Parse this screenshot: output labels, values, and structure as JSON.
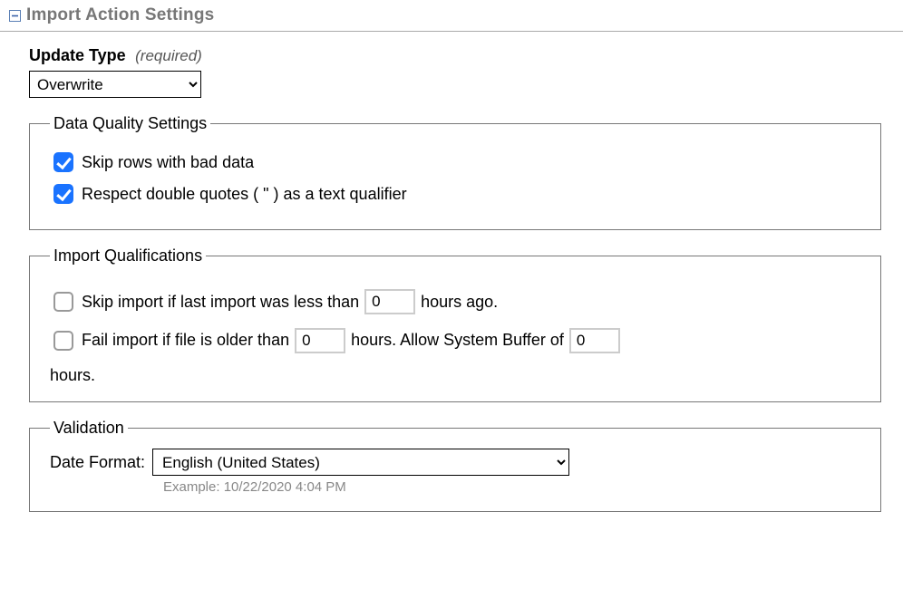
{
  "header": {
    "title": "Import Action Settings"
  },
  "updateType": {
    "label": "Update Type",
    "hint": "(required)",
    "value": "Overwrite"
  },
  "dataQuality": {
    "legend": "Data Quality Settings",
    "skipBadRows": {
      "checked": true,
      "label": "Skip rows with bad data"
    },
    "respectQuotes": {
      "checked": true,
      "label": "Respect double quotes ( \" ) as a text qualifier"
    }
  },
  "importQualifications": {
    "legend": "Import Qualifications",
    "skipIfRecent": {
      "checked": false,
      "pre": "Skip import if last import was less than",
      "value": "0",
      "post": "hours ago."
    },
    "failIfOld": {
      "checked": false,
      "pre": "Fail import if file is older than",
      "value": "0",
      "mid": "hours. Allow System Buffer of",
      "bufferValue": "0",
      "post": "hours."
    }
  },
  "validation": {
    "legend": "Validation",
    "dateFormatLabel": "Date Format:",
    "dateFormatValue": "English (United States)",
    "example": "Example: 10/22/2020 4:04 PM"
  }
}
